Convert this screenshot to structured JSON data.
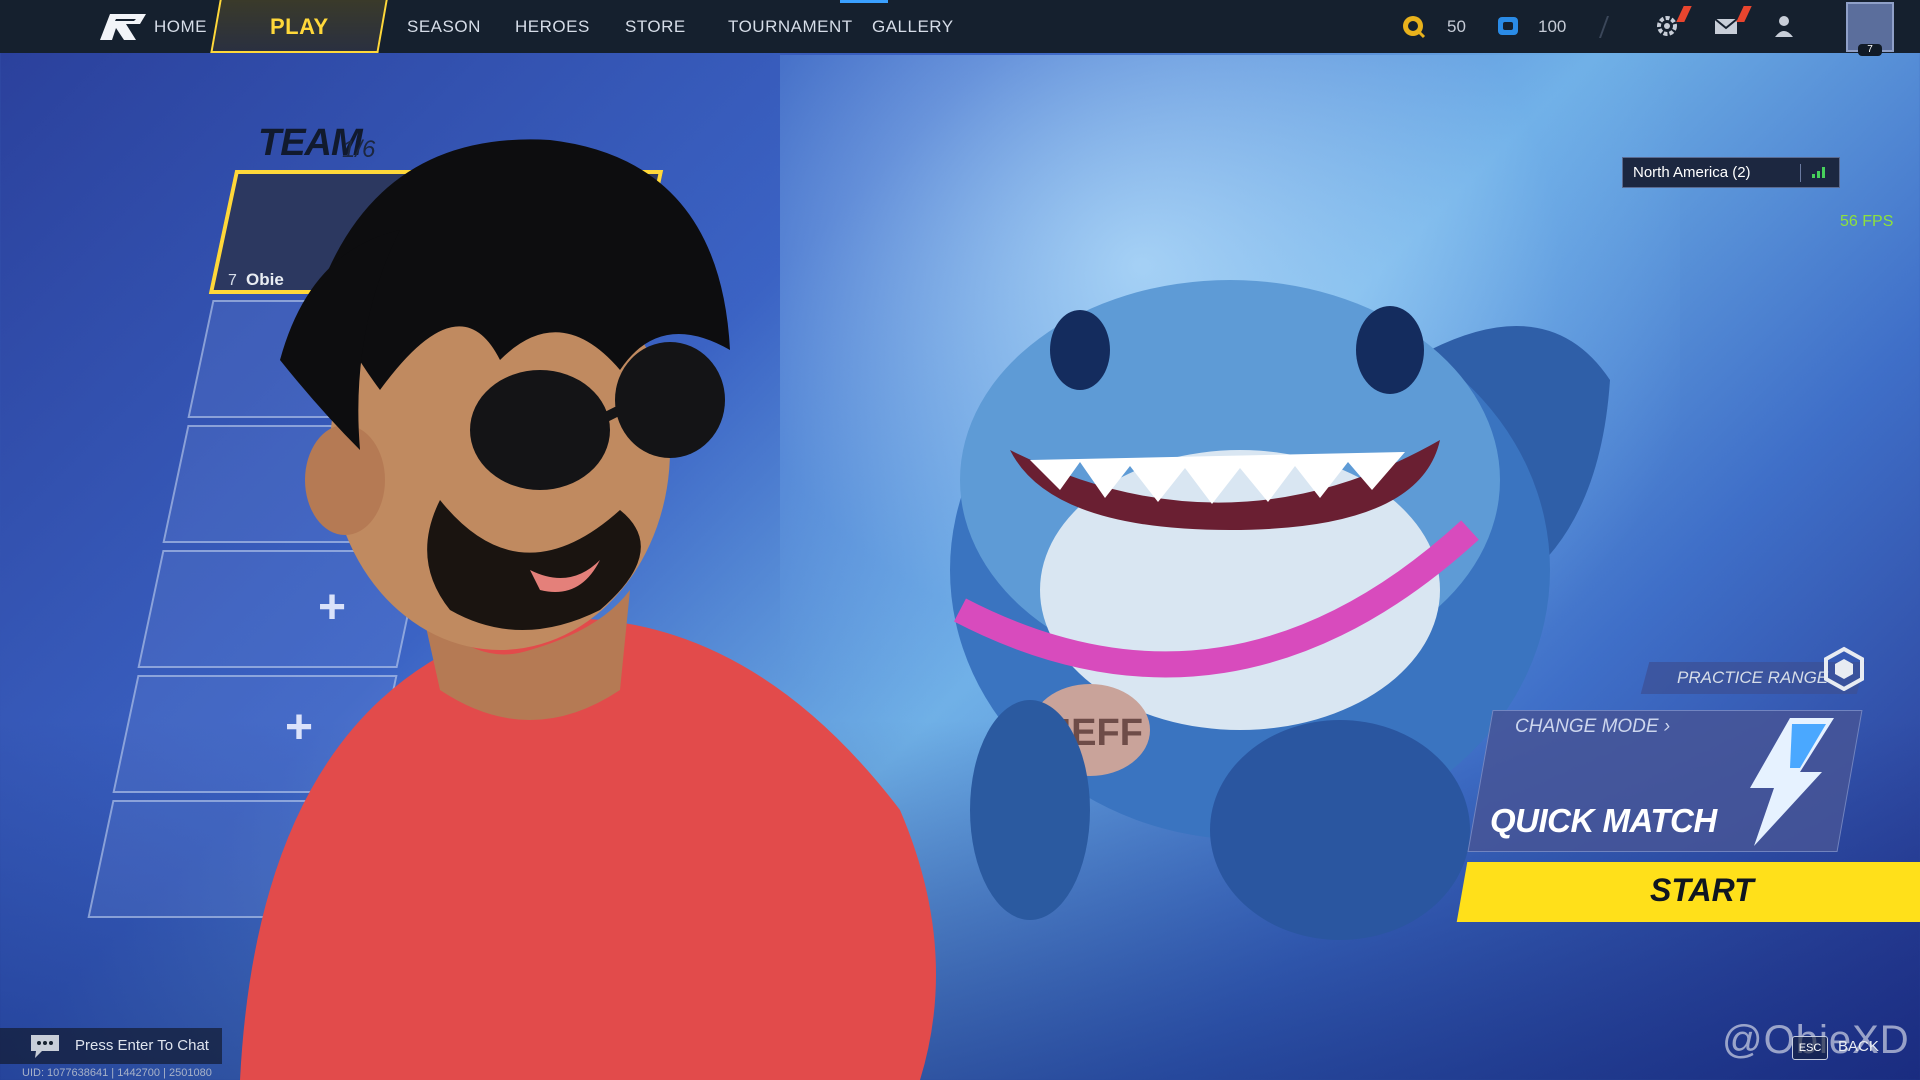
{
  "nav": {
    "home": "HOME",
    "play": "PLAY",
    "season": "SEASON",
    "heroes": "HEROES",
    "store": "STORE",
    "tournament": "TOURNAMENT",
    "gallery": "GALLERY"
  },
  "currency": {
    "lattice": "50",
    "units": "100"
  },
  "icons": {
    "logo": "game-logo-icon",
    "lattice": "lattice-currency-icon",
    "units": "units-currency-icon",
    "settings": "gear-icon",
    "mail": "mail-icon",
    "friends": "friends-icon",
    "profile": "profile-avatar-icon"
  },
  "profile": {
    "level": "7"
  },
  "server": {
    "region": "North America (2)",
    "fps": "56 FPS"
  },
  "team": {
    "title": "TEAM",
    "count": "1/6",
    "player": {
      "level": "7",
      "name": "Obie"
    },
    "add_symbol": "+"
  },
  "shark": {
    "tag": "JEFF"
  },
  "mode": {
    "practice_range": "PRACTICE RANGE",
    "change_mode": "CHANGE MODE",
    "current": "QUICK MATCH",
    "start": "START"
  },
  "footer": {
    "chat_prompt": "Press Enter To Chat",
    "uid": "UID: 1077638641 | 1442700 | 2501080",
    "esc_key": "ESC",
    "back": "BACK",
    "watermark": "@ObieXD"
  },
  "colors": {
    "accent": "#ffd83a",
    "start_button": "#ffe01a",
    "fps": "#8ee23a",
    "alert": "#e8452e",
    "topbar": "#15202e"
  }
}
